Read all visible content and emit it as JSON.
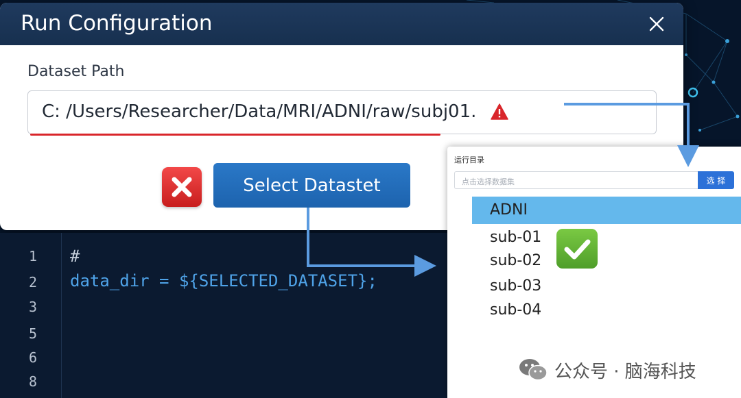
{
  "dialog": {
    "title": "Run Configuration",
    "field_label": "Dataset Path",
    "path_value": "C: /Users/Researcher/Data/MRI/ADNI/raw/subj01.",
    "select_button_label": "Select Datastet"
  },
  "editor": {
    "line_numbers": [
      "1",
      "2",
      "3",
      "5",
      "6",
      "8"
    ],
    "line_1": "#",
    "line_2": "data_dir = ${SELECTED_DATASET};"
  },
  "picker": {
    "title": "运行目录",
    "placeholder": "点击选择数据集",
    "button_label": "选 择",
    "items": [
      "ADNI",
      "sub-01",
      "sub-02",
      "sub-03",
      "sub-04"
    ]
  },
  "watermark": {
    "text": "公众号 · 脑海科技"
  },
  "colors": {
    "header": "#1f3a5e",
    "primary_button": "#2a78c7",
    "error": "#d9262b",
    "selected_row": "#64b8ec",
    "success": "#6abf3c",
    "code_text": "#4fa3e8",
    "editor_bg": "#0b1a30"
  },
  "icons": [
    "close-icon",
    "warning-icon",
    "error-x-icon",
    "checkmark-icon",
    "wechat-logo-icon"
  ]
}
